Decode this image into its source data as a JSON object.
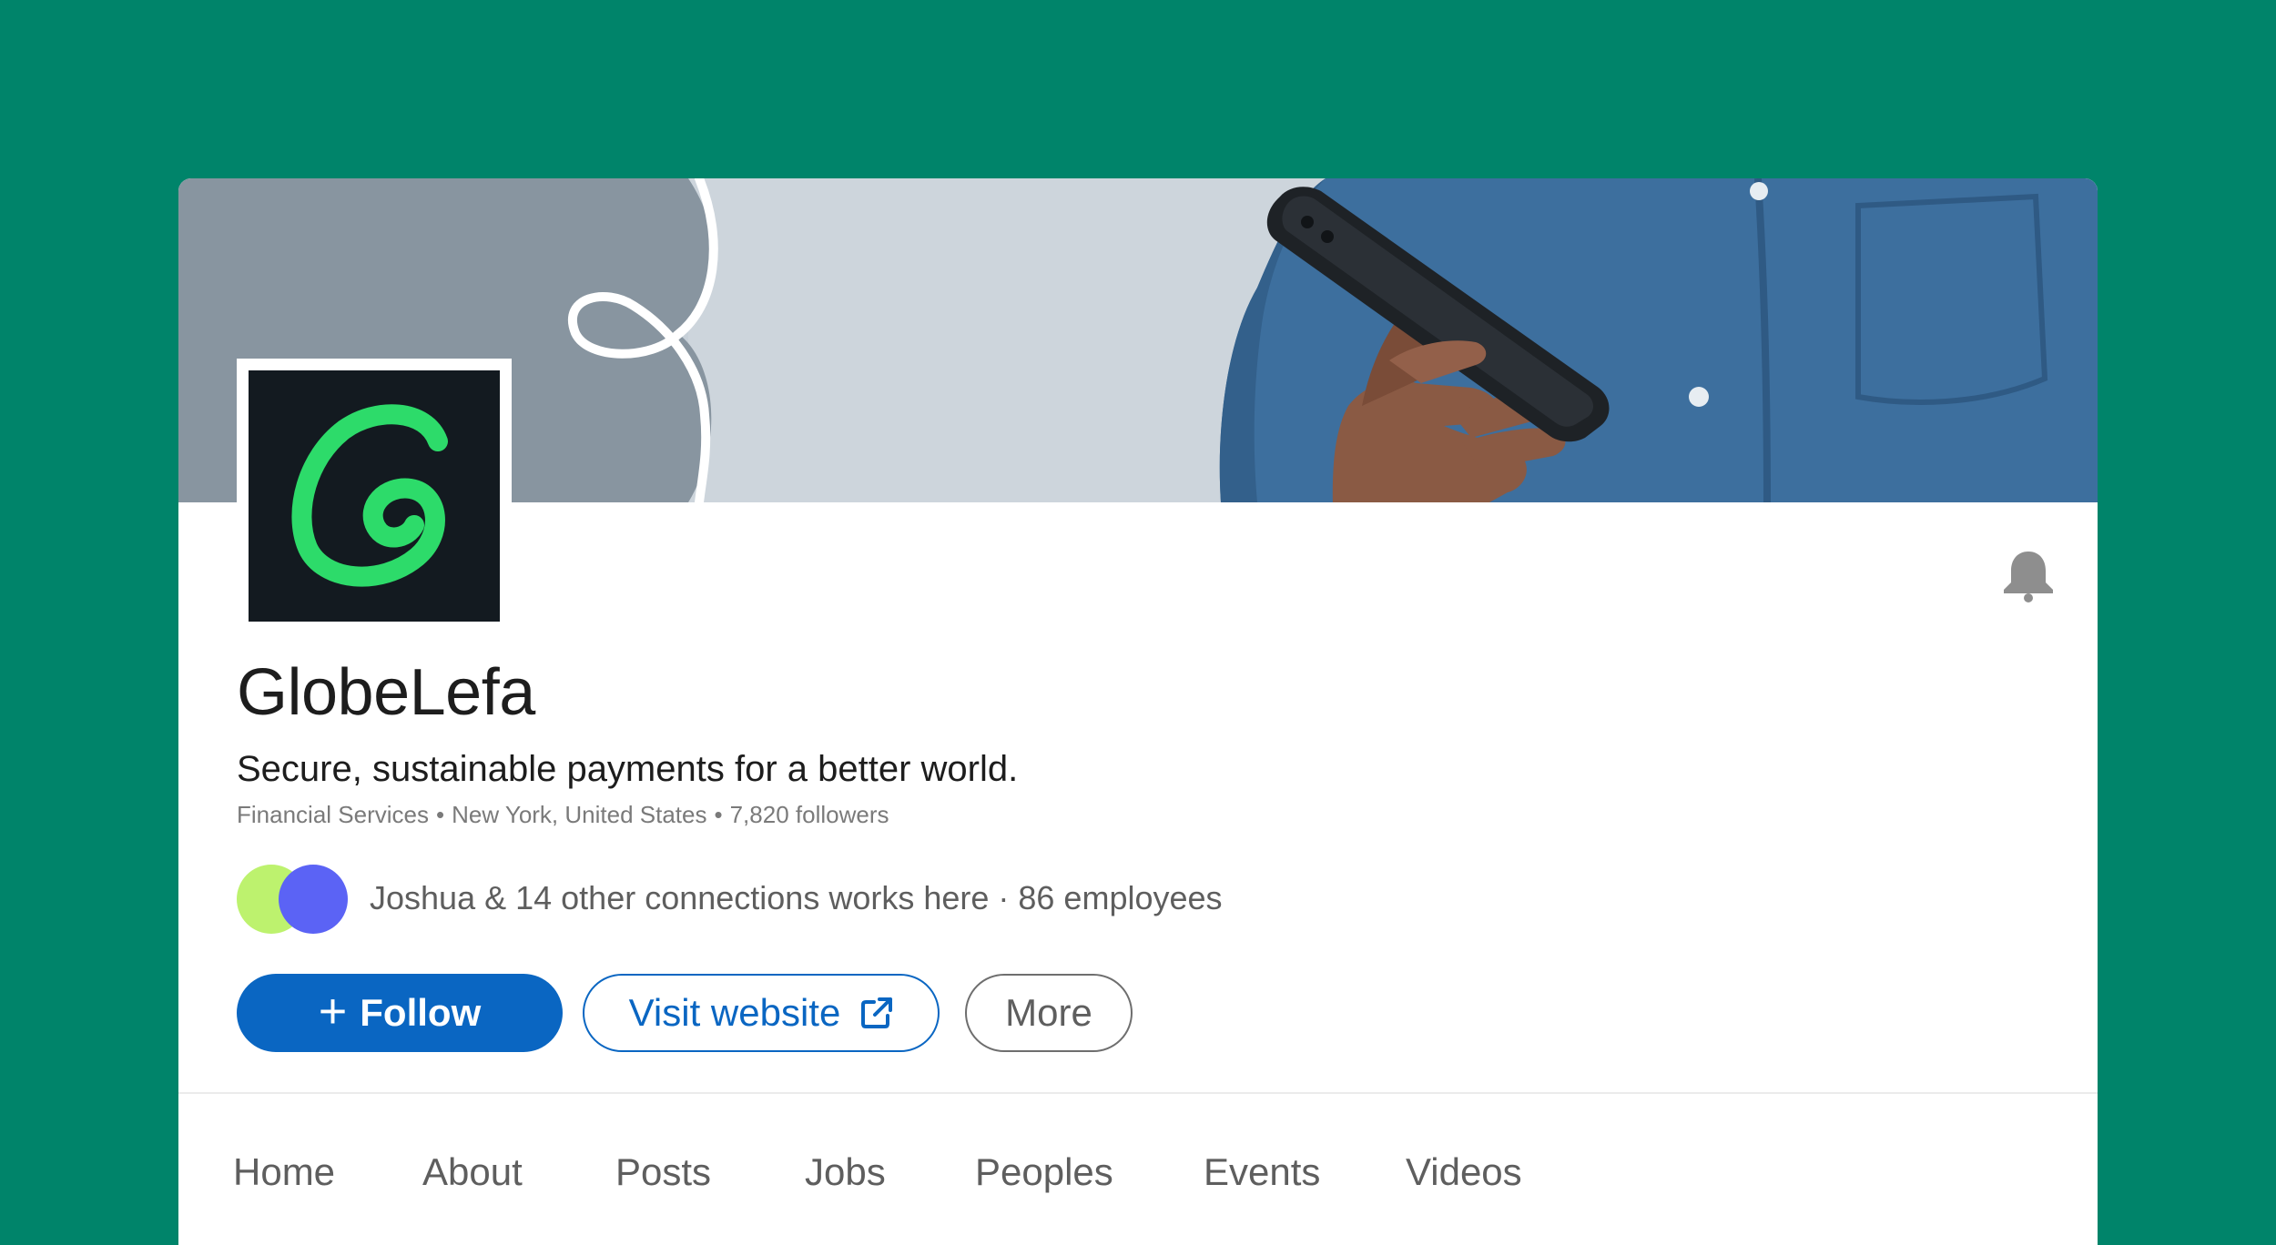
{
  "company": {
    "name": "GlobeLefa",
    "tagline": "Secure, sustainable payments for a better world.",
    "industry": "Financial Services",
    "location": "New York, United States",
    "followers": "7,820 followers",
    "meta_separator": "•",
    "logo_icon": "g-spiral-logo-icon"
  },
  "connections": {
    "text": "Joshua & 14 other connections works here · 86 employees",
    "avatar_colors": [
      "#BDF26E",
      "#5B63F5"
    ]
  },
  "actions": {
    "follow_label": "Follow",
    "follow_icon": "plus-icon",
    "website_label": "Visit website",
    "website_icon": "external-link-icon",
    "more_label": "More",
    "notification_icon": "bell-icon"
  },
  "nav": {
    "items": [
      "Home",
      "About",
      "Posts",
      "Jobs",
      "Peoples",
      "Events",
      "Videos"
    ]
  },
  "colors": {
    "page_background": "#00846A",
    "brand_green": "#2DDB6A",
    "logo_background": "#131A20",
    "primary_blue": "#0A66C2"
  }
}
